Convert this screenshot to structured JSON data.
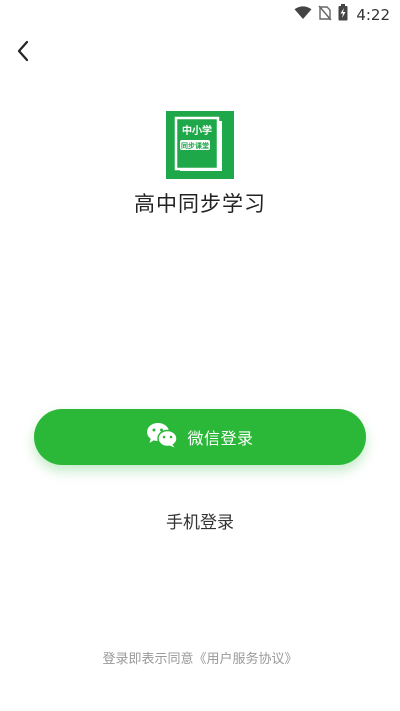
{
  "status_bar": {
    "time": "4:22",
    "icons": [
      "wifi-icon",
      "no-sim-icon",
      "battery-charging-icon"
    ]
  },
  "header": {
    "back_icon": "chevron-left-icon"
  },
  "app": {
    "logo_top_text": "中小学",
    "logo_badge_text": "同步课堂",
    "name": "高中同步学习"
  },
  "login": {
    "wechat_label": "微信登录",
    "phone_label": "手机登录"
  },
  "agreement": {
    "prefix": "登录即表示同意",
    "link": "《用户服务协议》"
  },
  "colors": {
    "primary_green": "#2bb838",
    "logo_green": "#1fa84a",
    "text_dark": "#222222",
    "text_muted": "#999999"
  }
}
